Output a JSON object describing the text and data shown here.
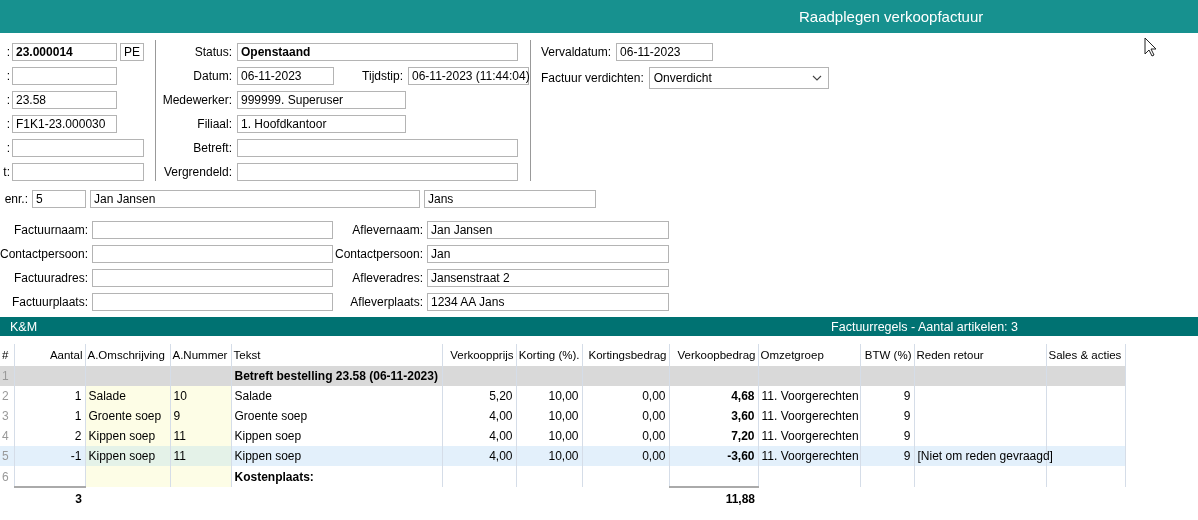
{
  "window": {
    "title": "Raadplegen verkoopfactuur"
  },
  "left_fields": [
    {
      "label": ":",
      "value": "23.000014",
      "bold": true,
      "suffix": "PE"
    },
    {
      "label": ":"
    },
    {
      "label": ":",
      "value": "23.58"
    },
    {
      "label": ":",
      "value": "F1K1-23.000030"
    },
    {
      "label": ":"
    },
    {
      "label": "t:"
    }
  ],
  "mid_fields": [
    {
      "label": "Status:",
      "value": "Openstaand",
      "bold": true
    },
    {
      "label": "Datum:",
      "value": "06-11-2023",
      "extra_label": "Tijdstip:",
      "extra_value": "06-11-2023 (11:44:04)"
    },
    {
      "label": "Medewerker:",
      "value": "999999. Superuser"
    },
    {
      "label": "Filiaal:",
      "value": "1. Hoofdkantoor"
    },
    {
      "label": "Betreft:"
    },
    {
      "label": "Vergrendeld:"
    }
  ],
  "vervaldatum": {
    "label": "Vervaldatum:",
    "value": "06-11-2023"
  },
  "verdichten": {
    "label": "Factuur verdichten:",
    "value": "Onverdicht"
  },
  "customer": {
    "label": "enr.:",
    "number": "5",
    "name": "Jan Jansen",
    "short": "Jans"
  },
  "invoice_address": [
    {
      "label": "Factuurnaam:"
    },
    {
      "label": "Contactpersoon:"
    },
    {
      "label": "Factuuradres:"
    },
    {
      "label": "Factuurplaats:"
    }
  ],
  "delivery_address": [
    {
      "label": "Aflevernaam:",
      "value": "Jan Jansen"
    },
    {
      "label": "Contactpersoon:",
      "value": "Jan"
    },
    {
      "label": "Afleveradres:",
      "value": "Jansenstraat 2"
    },
    {
      "label": "Afleverplaats:",
      "value": "1234 AA Jans"
    }
  ],
  "grid_bar": {
    "left": "K&M",
    "title": "Factuurregels - Aantal artikelen: 3"
  },
  "table": {
    "columns": [
      "#",
      "Aantal",
      "A.Omschrijving",
      "A.Nummer",
      "Tekst",
      "Verkoopprijs",
      "Korting (%).",
      "Kortingsbedrag",
      "Verkoopbedrag",
      "Omzetgroep",
      "BTW (%)",
      "Reden retour",
      "Sales & acties"
    ],
    "rows": [
      {
        "kind": "group",
        "selected": false,
        "cells": {
          "no": "1",
          "tekst": "Betreft bestelling 23.58 (06-11-2023)"
        }
      },
      {
        "kind": "item",
        "selected": false,
        "cells": {
          "no": "2",
          "aantal": "1",
          "omschrijving": "Salade",
          "nummer": "10",
          "tekst": "Salade",
          "prijs": "5,20",
          "korting": "10,00",
          "kortingsbedrag": "0,00",
          "bedrag": "4,68",
          "omzetgroep": "11. Voorgerechten",
          "btw": "9"
        }
      },
      {
        "kind": "item",
        "selected": false,
        "cells": {
          "no": "3",
          "aantal": "1",
          "omschrijving": "Groente soep",
          "nummer": "9",
          "tekst": "Groente soep",
          "prijs": "4,00",
          "korting": "10,00",
          "kortingsbedrag": "0,00",
          "bedrag": "3,60",
          "omzetgroep": "11. Voorgerechten",
          "btw": "9"
        }
      },
      {
        "kind": "item",
        "selected": false,
        "cells": {
          "no": "4",
          "aantal": "2",
          "omschrijving": "Kippen soep",
          "nummer": "11",
          "tekst": "Kippen soep",
          "prijs": "4,00",
          "korting": "10,00",
          "kortingsbedrag": "0,00",
          "bedrag": "7,20",
          "omzetgroep": "11. Voorgerechten",
          "btw": "9"
        }
      },
      {
        "kind": "item",
        "selected": true,
        "cells": {
          "no": "5",
          "aantal": "-1",
          "omschrijving": "Kippen soep",
          "nummer": "11",
          "tekst": "Kippen soep",
          "prijs": "4,00",
          "korting": "10,00",
          "kortingsbedrag": "0,00",
          "bedrag": "-3,60",
          "omzetgroep": "11. Voorgerechten",
          "btw": "9",
          "reden": "[Niet om reden gevraagd]"
        }
      },
      {
        "kind": "note",
        "selected": false,
        "cells": {
          "no": "6",
          "tekst": "Kostenplaats:"
        }
      }
    ],
    "totals": {
      "aantal": "3",
      "bedrag": "11,88"
    }
  }
}
